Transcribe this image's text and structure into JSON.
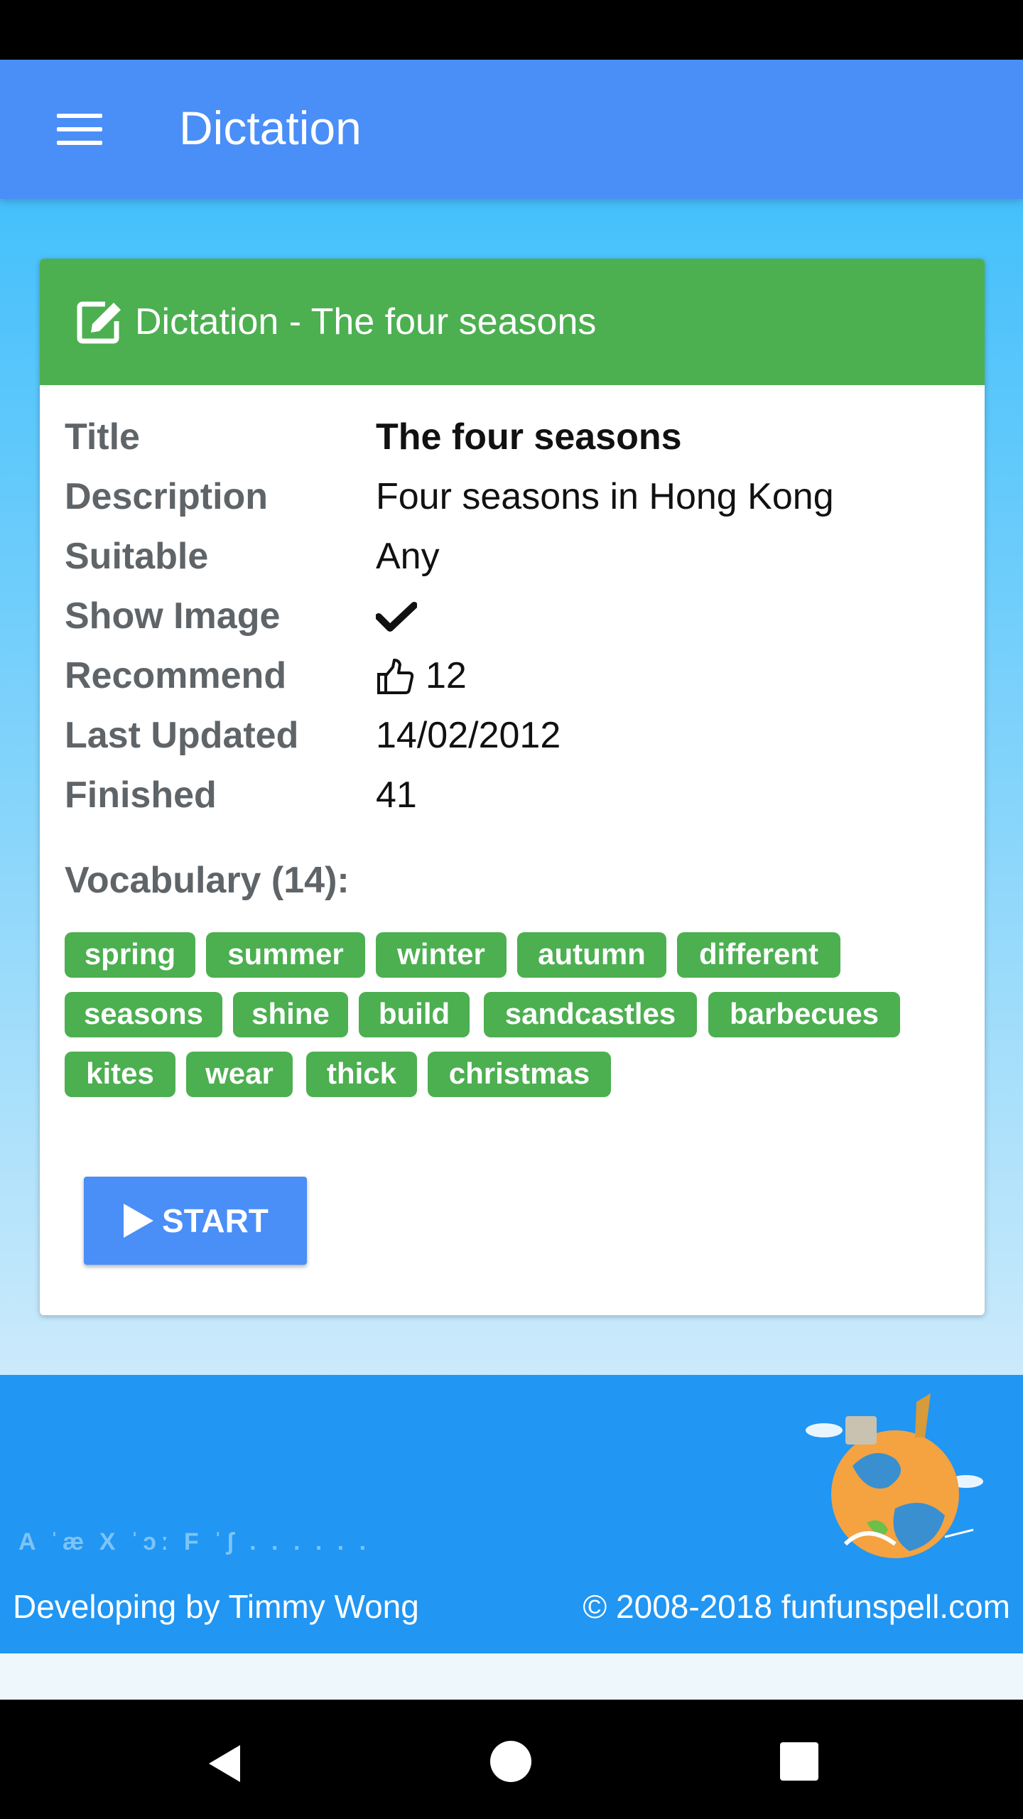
{
  "app_bar": {
    "title": "Dictation"
  },
  "card": {
    "header_title": "Dictation - The four seasons",
    "rows": [
      {
        "label": "Title",
        "value": "The four seasons"
      },
      {
        "label": "Description",
        "value": "Four seasons in Hong Kong"
      },
      {
        "label": "Suitable",
        "value": "Any"
      },
      {
        "label": "Show Image",
        "value": "check"
      },
      {
        "label": "Recommend",
        "value": "12"
      },
      {
        "label": "Last Updated",
        "value": "14/02/2012"
      },
      {
        "label": "Finished",
        "value": "41"
      }
    ],
    "vocab_title": "Vocabulary (14):",
    "vocab": [
      "spring",
      "summer",
      "winter",
      "autumn",
      "different",
      "seasons",
      "shine",
      "build",
      "sandcastles",
      "barbecues",
      "kites",
      "wear",
      "thick",
      "christmas"
    ],
    "start_label": "START"
  },
  "footer": {
    "developer": "Developing by Timmy Wong",
    "copyright": "© 2008-2018 funfunspell.com",
    "decor_letters": "A ˈæ X ˈɔː F ˈʃ . . . . . ."
  },
  "colors": {
    "app_bar": "#4a8ef8",
    "card_header": "#4caf50",
    "tag": "#4caf50",
    "start_button": "#4a8ef8",
    "footer": "#2196f3"
  },
  "icons": {
    "menu": "menu-icon",
    "edit": "edit-icon",
    "show_image": "check-icon",
    "recommend": "thumbs-up-icon",
    "start": "play-icon",
    "nav": [
      "back-icon",
      "home-icon",
      "recent-apps-icon"
    ]
  }
}
